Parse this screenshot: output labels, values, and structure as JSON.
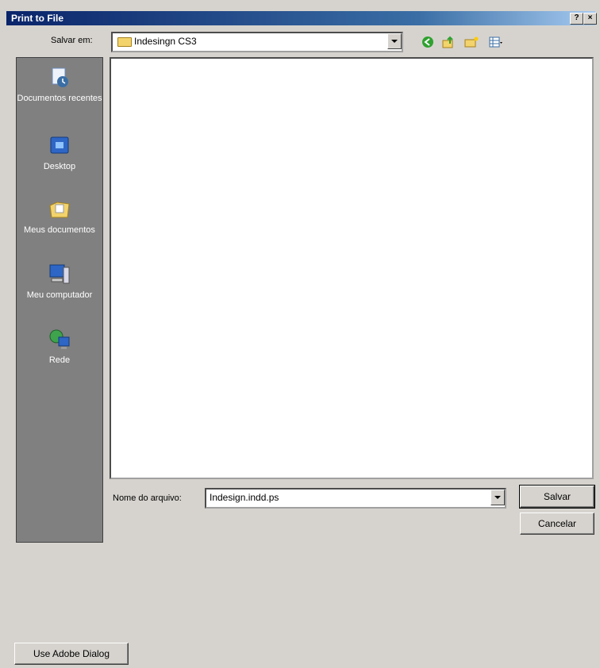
{
  "window": {
    "title": "Print to File",
    "help_label": "?",
    "close_label": "×"
  },
  "location": {
    "label": "Salvar em:",
    "value": "Indesingn CS3"
  },
  "toolbar_icons": [
    "back-icon",
    "up-folder-icon",
    "new-folder-icon",
    "view-menu-icon"
  ],
  "places": [
    {
      "label": "Documentos recentes",
      "icon": "recent-documents-icon"
    },
    {
      "label": "Desktop",
      "icon": "desktop-icon"
    },
    {
      "label": "Meus documentos",
      "icon": "my-documents-icon"
    },
    {
      "label": "Meu computador",
      "icon": "my-computer-icon"
    },
    {
      "label": "Rede",
      "icon": "network-icon"
    }
  ],
  "filename": {
    "label": "Nome do arquivo:",
    "value": "Indesign.indd.ps"
  },
  "buttons": {
    "save": "Salvar",
    "cancel": "Cancelar",
    "adobe": "Use Adobe Dialog"
  },
  "colors": {
    "title_bar": "#0a246a",
    "places_bar": "#808080",
    "face": "#d6d3ce"
  }
}
